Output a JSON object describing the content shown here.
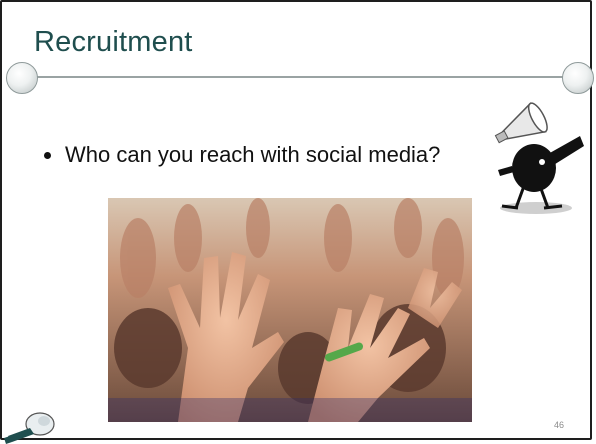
{
  "slide": {
    "title": "Recruitment",
    "bullets": [
      "Who can you reach with social media?"
    ],
    "slide_number": "46"
  },
  "icons": {
    "mascot": "megaphone-mascot-icon",
    "bottom_left": "figure-corner-icon"
  },
  "colors": {
    "title": "#1f4e4e",
    "rule": "#9aa3a3",
    "frame": "#1e1e1e"
  },
  "image": {
    "subject": "crowd-raised-hands-photo"
  }
}
